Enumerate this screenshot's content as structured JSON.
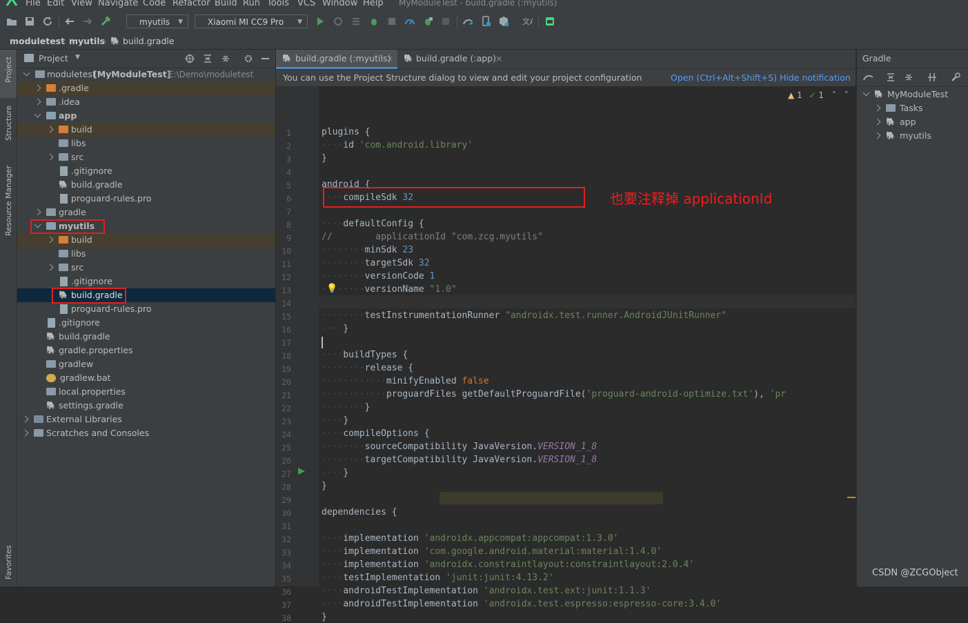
{
  "menu": {
    "items": [
      "File",
      "Edit",
      "View",
      "Navigate",
      "Code",
      "Refactor",
      "Build",
      "Run",
      "Tools",
      "VCS",
      "Window",
      "Help"
    ],
    "window_title": "MyModuleTest - build.gradle (:myutils)"
  },
  "toolbar": {
    "module_config": "myutils",
    "device": "Xiaomi MI CC9 Pro"
  },
  "breadcrumb": [
    "moduletest",
    "myutils",
    "build.gradle"
  ],
  "left_stripe": {
    "project_tab": "Project",
    "structure_tab": "Structure",
    "resource_tab": "Resource Manager",
    "favorites_tab": "Favorites"
  },
  "project_panel": {
    "view_label": "Project",
    "root_name": "moduletest",
    "root_module": "[MyModuleTest]",
    "root_path": "E:\\Demo\\moduletest",
    "items": [
      {
        "label": ".gradle"
      },
      {
        "label": ".idea"
      },
      {
        "label": "app"
      },
      {
        "label": "build"
      },
      {
        "label": "libs"
      },
      {
        "label": "src"
      },
      {
        "label": ".gitignore"
      },
      {
        "label": "build.gradle"
      },
      {
        "label": "proguard-rules.pro"
      },
      {
        "label": "gradle"
      },
      {
        "label": "myutils"
      },
      {
        "label": "build"
      },
      {
        "label": "libs"
      },
      {
        "label": "src"
      },
      {
        "label": ".gitignore"
      },
      {
        "label": "build.gradle"
      },
      {
        "label": "proguard-rules.pro"
      },
      {
        "label": ".gitignore"
      },
      {
        "label": "build.gradle"
      },
      {
        "label": "gradle.properties"
      },
      {
        "label": "gradlew"
      },
      {
        "label": "gradlew.bat"
      },
      {
        "label": "local.properties"
      },
      {
        "label": "settings.gradle"
      },
      {
        "label": "External Libraries"
      },
      {
        "label": "Scratches and Consoles"
      }
    ]
  },
  "editor": {
    "tabs": [
      {
        "label": "build.gradle (:myutils)",
        "active": true
      },
      {
        "label": "build.gradle (:app)",
        "active": false
      }
    ],
    "notification": {
      "message": "You can use the Project Structure dialog to view and edit your project configuration",
      "open_link": "Open (Ctrl+Alt+Shift+S)",
      "hide_link": "Hide notification"
    },
    "inspections": {
      "warnings": "1",
      "ok": "1"
    },
    "lines": [
      {
        "n": "1",
        "t": "plugins {"
      },
      {
        "n": "2",
        "t": "    id 'com.android.library'"
      },
      {
        "n": "3",
        "t": "}"
      },
      {
        "n": "4",
        "t": ""
      },
      {
        "n": "5",
        "t": "android {"
      },
      {
        "n": "6",
        "t": "    compileSdk 32"
      },
      {
        "n": "7",
        "t": ""
      },
      {
        "n": "8",
        "t": "    defaultConfig {"
      },
      {
        "n": "9",
        "t": "//        applicationId \"com.zcg.myutils\""
      },
      {
        "n": "10",
        "t": "        minSdk 23"
      },
      {
        "n": "11",
        "t": "        targetSdk 32"
      },
      {
        "n": "12",
        "t": "        versionCode 1"
      },
      {
        "n": "13",
        "t": "        versionName \"1.0\""
      },
      {
        "n": "14",
        "t": ""
      },
      {
        "n": "15",
        "t": "        testInstrumentationRunner \"androidx.test.runner.AndroidJUnitRunner\""
      },
      {
        "n": "16",
        "t": "    }"
      },
      {
        "n": "17",
        "t": ""
      },
      {
        "n": "18",
        "t": "    buildTypes {"
      },
      {
        "n": "19",
        "t": "        release {"
      },
      {
        "n": "20",
        "t": "            minifyEnabled false"
      },
      {
        "n": "21",
        "t": "            proguardFiles getDefaultProguardFile('proguard-android-optimize.txt'), 'pr"
      },
      {
        "n": "22",
        "t": "        }"
      },
      {
        "n": "23",
        "t": "    }"
      },
      {
        "n": "24",
        "t": "    compileOptions {"
      },
      {
        "n": "25",
        "t": "        sourceCompatibility JavaVersion.VERSION_1_8"
      },
      {
        "n": "26",
        "t": "        targetCompatibility JavaVersion.VERSION_1_8"
      },
      {
        "n": "27",
        "t": "    }"
      },
      {
        "n": "28",
        "t": "}"
      },
      {
        "n": "29",
        "t": ""
      },
      {
        "n": "30",
        "t": "dependencies {"
      },
      {
        "n": "31",
        "t": ""
      },
      {
        "n": "32",
        "t": "    implementation 'androidx.appcompat:appcompat:1.3.0'"
      },
      {
        "n": "33",
        "t": "    implementation 'com.google.android.material:material:1.4.0'"
      },
      {
        "n": "34",
        "t": "    implementation 'androidx.constraintlayout:constraintlayout:2.0.4'"
      },
      {
        "n": "35",
        "t": "    testImplementation 'junit:junit:4.13.2'"
      },
      {
        "n": "36",
        "t": "    androidTestImplementation 'androidx.test.ext:junit:1.1.3'"
      },
      {
        "n": "37",
        "t": "    androidTestImplementation 'androidx.test.espresso:espresso-core:3.4.0'"
      },
      {
        "n": "38",
        "t": "}"
      }
    ]
  },
  "gradle_panel": {
    "title": "Gradle",
    "root": "MyModuleTest",
    "items": [
      "Tasks",
      "app",
      "myutils"
    ]
  },
  "annotation": "也要注释掉 applicationId",
  "watermark": "CSDN @ZCGObject",
  "colors": {
    "accent": "#4a88c7",
    "annotation_red": "#e02020",
    "selection": "#0d293e"
  }
}
